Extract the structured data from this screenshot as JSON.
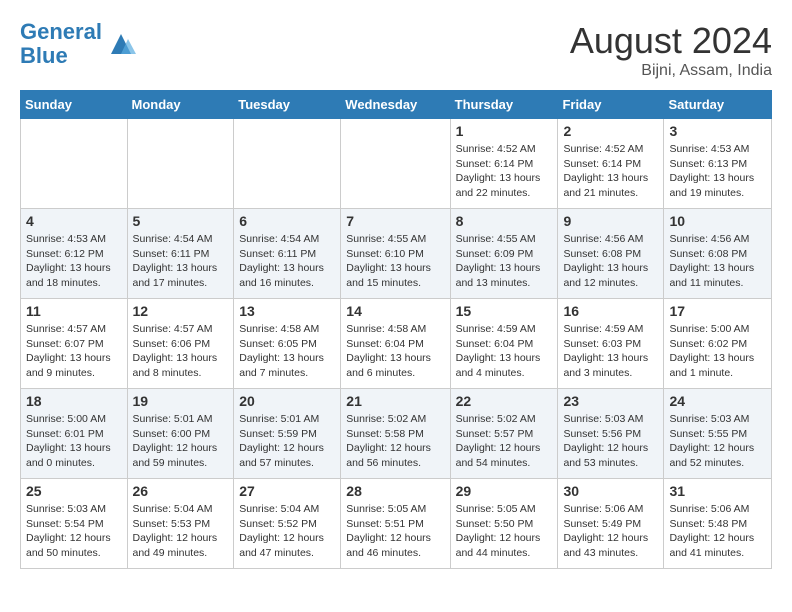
{
  "header": {
    "logo_line1": "General",
    "logo_line2": "Blue",
    "month_title": "August 2024",
    "location": "Bijni, Assam, India"
  },
  "weekdays": [
    "Sunday",
    "Monday",
    "Tuesday",
    "Wednesday",
    "Thursday",
    "Friday",
    "Saturday"
  ],
  "weeks": [
    [
      {
        "day": "",
        "info": ""
      },
      {
        "day": "",
        "info": ""
      },
      {
        "day": "",
        "info": ""
      },
      {
        "day": "",
        "info": ""
      },
      {
        "day": "1",
        "info": "Sunrise: 4:52 AM\nSunset: 6:14 PM\nDaylight: 13 hours and 22 minutes."
      },
      {
        "day": "2",
        "info": "Sunrise: 4:52 AM\nSunset: 6:14 PM\nDaylight: 13 hours and 21 minutes."
      },
      {
        "day": "3",
        "info": "Sunrise: 4:53 AM\nSunset: 6:13 PM\nDaylight: 13 hours and 19 minutes."
      }
    ],
    [
      {
        "day": "4",
        "info": "Sunrise: 4:53 AM\nSunset: 6:12 PM\nDaylight: 13 hours and 18 minutes."
      },
      {
        "day": "5",
        "info": "Sunrise: 4:54 AM\nSunset: 6:11 PM\nDaylight: 13 hours and 17 minutes."
      },
      {
        "day": "6",
        "info": "Sunrise: 4:54 AM\nSunset: 6:11 PM\nDaylight: 13 hours and 16 minutes."
      },
      {
        "day": "7",
        "info": "Sunrise: 4:55 AM\nSunset: 6:10 PM\nDaylight: 13 hours and 15 minutes."
      },
      {
        "day": "8",
        "info": "Sunrise: 4:55 AM\nSunset: 6:09 PM\nDaylight: 13 hours and 13 minutes."
      },
      {
        "day": "9",
        "info": "Sunrise: 4:56 AM\nSunset: 6:08 PM\nDaylight: 13 hours and 12 minutes."
      },
      {
        "day": "10",
        "info": "Sunrise: 4:56 AM\nSunset: 6:08 PM\nDaylight: 13 hours and 11 minutes."
      }
    ],
    [
      {
        "day": "11",
        "info": "Sunrise: 4:57 AM\nSunset: 6:07 PM\nDaylight: 13 hours and 9 minutes."
      },
      {
        "day": "12",
        "info": "Sunrise: 4:57 AM\nSunset: 6:06 PM\nDaylight: 13 hours and 8 minutes."
      },
      {
        "day": "13",
        "info": "Sunrise: 4:58 AM\nSunset: 6:05 PM\nDaylight: 13 hours and 7 minutes."
      },
      {
        "day": "14",
        "info": "Sunrise: 4:58 AM\nSunset: 6:04 PM\nDaylight: 13 hours and 6 minutes."
      },
      {
        "day": "15",
        "info": "Sunrise: 4:59 AM\nSunset: 6:04 PM\nDaylight: 13 hours and 4 minutes."
      },
      {
        "day": "16",
        "info": "Sunrise: 4:59 AM\nSunset: 6:03 PM\nDaylight: 13 hours and 3 minutes."
      },
      {
        "day": "17",
        "info": "Sunrise: 5:00 AM\nSunset: 6:02 PM\nDaylight: 13 hours and 1 minute."
      }
    ],
    [
      {
        "day": "18",
        "info": "Sunrise: 5:00 AM\nSunset: 6:01 PM\nDaylight: 13 hours and 0 minutes."
      },
      {
        "day": "19",
        "info": "Sunrise: 5:01 AM\nSunset: 6:00 PM\nDaylight: 12 hours and 59 minutes."
      },
      {
        "day": "20",
        "info": "Sunrise: 5:01 AM\nSunset: 5:59 PM\nDaylight: 12 hours and 57 minutes."
      },
      {
        "day": "21",
        "info": "Sunrise: 5:02 AM\nSunset: 5:58 PM\nDaylight: 12 hours and 56 minutes."
      },
      {
        "day": "22",
        "info": "Sunrise: 5:02 AM\nSunset: 5:57 PM\nDaylight: 12 hours and 54 minutes."
      },
      {
        "day": "23",
        "info": "Sunrise: 5:03 AM\nSunset: 5:56 PM\nDaylight: 12 hours and 53 minutes."
      },
      {
        "day": "24",
        "info": "Sunrise: 5:03 AM\nSunset: 5:55 PM\nDaylight: 12 hours and 52 minutes."
      }
    ],
    [
      {
        "day": "25",
        "info": "Sunrise: 5:03 AM\nSunset: 5:54 PM\nDaylight: 12 hours and 50 minutes."
      },
      {
        "day": "26",
        "info": "Sunrise: 5:04 AM\nSunset: 5:53 PM\nDaylight: 12 hours and 49 minutes."
      },
      {
        "day": "27",
        "info": "Sunrise: 5:04 AM\nSunset: 5:52 PM\nDaylight: 12 hours and 47 minutes."
      },
      {
        "day": "28",
        "info": "Sunrise: 5:05 AM\nSunset: 5:51 PM\nDaylight: 12 hours and 46 minutes."
      },
      {
        "day": "29",
        "info": "Sunrise: 5:05 AM\nSunset: 5:50 PM\nDaylight: 12 hours and 44 minutes."
      },
      {
        "day": "30",
        "info": "Sunrise: 5:06 AM\nSunset: 5:49 PM\nDaylight: 12 hours and 43 minutes."
      },
      {
        "day": "31",
        "info": "Sunrise: 5:06 AM\nSunset: 5:48 PM\nDaylight: 12 hours and 41 minutes."
      }
    ]
  ]
}
